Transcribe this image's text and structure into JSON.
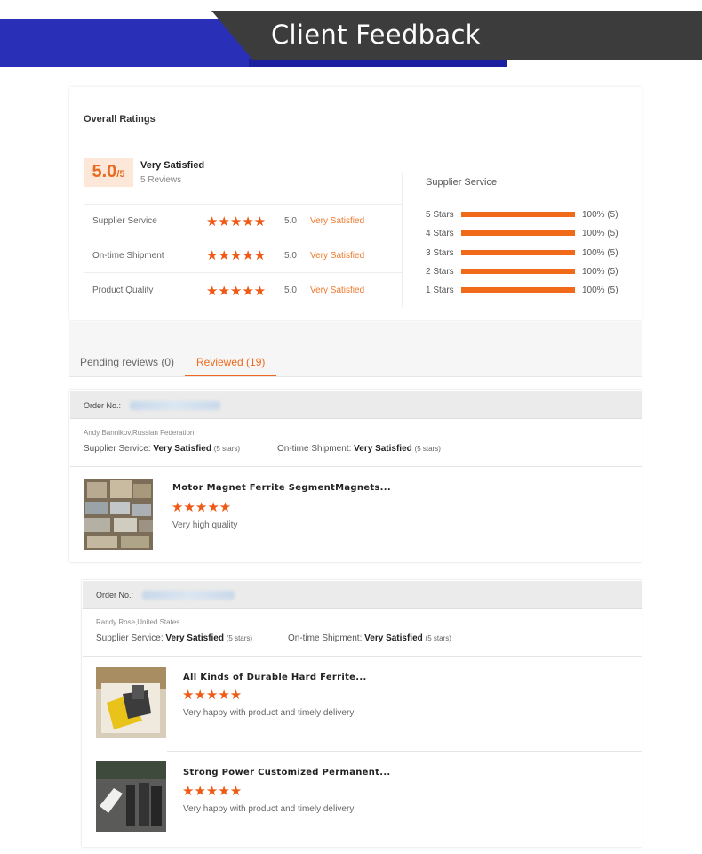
{
  "banner": {
    "title": "Client Feedback"
  },
  "overall": {
    "label": "Overall Ratings",
    "score": "5.0",
    "score_suffix": "/5",
    "status": "Very Satisfied",
    "reviews": "5 Reviews"
  },
  "ratings": [
    {
      "label": "Supplier Service",
      "stars": "★★★★★",
      "score": "5.0",
      "status": "Very Satisfied"
    },
    {
      "label": "On-time Shipment",
      "stars": "★★★★★",
      "score": "5.0",
      "status": "Very Satisfied"
    },
    {
      "label": "Product Quality",
      "stars": "★★★★★",
      "score": "5.0",
      "status": "Very Satisfied"
    }
  ],
  "supplier_service": {
    "title": "Supplier Service",
    "rows": [
      {
        "label": "5 Stars",
        "fill": 1.0,
        "pct": "100% (5)"
      },
      {
        "label": "4 Stars",
        "fill": 1.0,
        "pct": "100% (5)"
      },
      {
        "label": "3 Stars",
        "fill": 1.0,
        "pct": "100% (5)"
      },
      {
        "label": "2 Stars",
        "fill": 1.0,
        "pct": "100% (5)"
      },
      {
        "label": "1 Stars",
        "fill": 1.0,
        "pct": "100% (5)"
      }
    ]
  },
  "tabs": {
    "pending": "Pending reviews (0)",
    "reviewed": "Reviewed (19)"
  },
  "orders": [
    {
      "order_label": "Order No.:",
      "buyer": "Andy Bannikov,Russian Federation",
      "supplier_label": "Supplier Service:",
      "supplier_value": "Very Satisfied",
      "supplier_stars": "(5 stars)",
      "shipment_label": "On-time Shipment:",
      "shipment_value": "Very Satisfied",
      "shipment_stars": "(5 stars)",
      "products": [
        {
          "title": "Motor Magnet Ferrite SegmentMagnets...",
          "stars": "★★★★★",
          "comment": "Very high quality"
        }
      ]
    },
    {
      "order_label": "Order No.:",
      "buyer": "Randy Rose,United States",
      "supplier_label": "Supplier Service:",
      "supplier_value": "Very Satisfied",
      "supplier_stars": "(5 stars)",
      "shipment_label": "On-time Shipment:",
      "shipment_value": "Very Satisfied",
      "shipment_stars": "(5 stars)",
      "products": [
        {
          "title": "All Kinds of Durable Hard Ferrite...",
          "stars": "★★★★★",
          "comment": "Very happy with product and timely delivery"
        },
        {
          "title": "Strong Power Customized Permanent...",
          "stars": "★★★★★",
          "comment": "Very happy with product and timely delivery"
        }
      ]
    }
  ],
  "colors": {
    "accent": "#ef6a1e",
    "banner_blue": "#2a2fb8",
    "banner_dark": "#3c3c3c"
  }
}
